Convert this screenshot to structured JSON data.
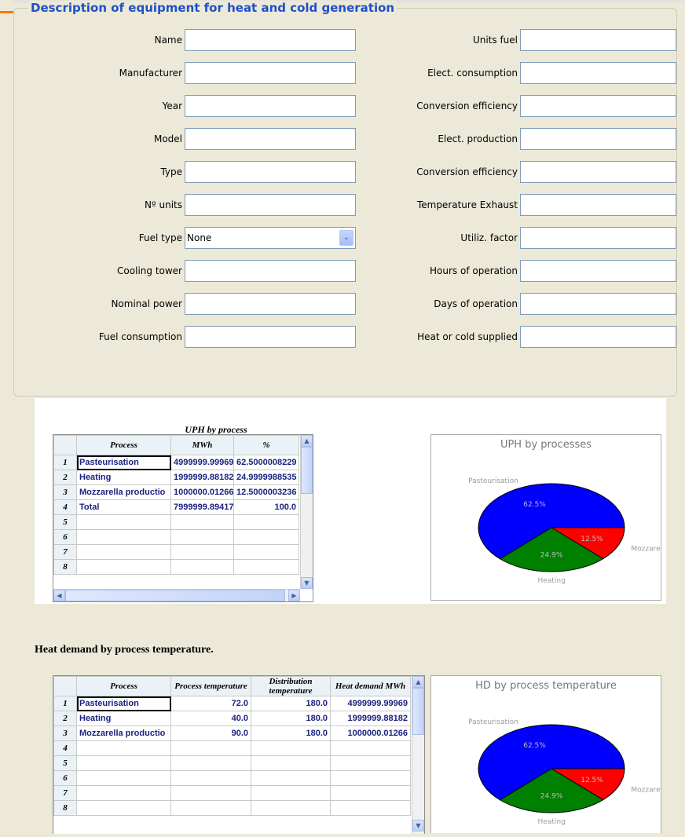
{
  "form": {
    "legend": "Description of equipment for heat and cold generation",
    "left_fields": [
      {
        "label": "Name",
        "value": ""
      },
      {
        "label": "Manufacturer",
        "value": ""
      },
      {
        "label": "Year",
        "value": ""
      },
      {
        "label": "Model",
        "value": ""
      },
      {
        "label": "Type",
        "value": ""
      },
      {
        "label": "Nº units",
        "value": ""
      },
      {
        "label": "Fuel type",
        "value": "None"
      },
      {
        "label": "Cooling tower",
        "value": ""
      },
      {
        "label": "Nominal power",
        "value": ""
      },
      {
        "label": "Fuel consumption",
        "value": ""
      }
    ],
    "right_fields": [
      {
        "label": "Units fuel",
        "value": ""
      },
      {
        "label": "Elect. consumption",
        "value": ""
      },
      {
        "label": "Conversion efficiency",
        "value": ""
      },
      {
        "label": "Elect. production",
        "value": ""
      },
      {
        "label": "Conversion efficiency",
        "value": ""
      },
      {
        "label": "Temperature Exhaust",
        "value": ""
      },
      {
        "label": "Utiliz. factor",
        "value": ""
      },
      {
        "label": "Hours of operation",
        "value": ""
      },
      {
        "label": "Days of operation",
        "value": ""
      },
      {
        "label": "Heat or cold supplied",
        "value": ""
      }
    ]
  },
  "uph_table": {
    "caption": "UPH by process",
    "headers": [
      "Process",
      "MWh",
      "%"
    ],
    "rows": [
      {
        "n": "1",
        "process": "Pasteurisation",
        "mwh": "4999999.99969",
        "pct": "62.5000008229"
      },
      {
        "n": "2",
        "process": "Heating",
        "mwh": "1999999.88182",
        "pct": "24.9999988535"
      },
      {
        "n": "3",
        "process": "Mozzarella productio",
        "mwh": "1000000.01266",
        "pct": "12.5000003236"
      },
      {
        "n": "4",
        "process": "Total",
        "mwh": "7999999.89417",
        "pct": "100.0"
      },
      {
        "n": "5",
        "process": "",
        "mwh": "",
        "pct": ""
      },
      {
        "n": "6",
        "process": "",
        "mwh": "",
        "pct": ""
      },
      {
        "n": "7",
        "process": "",
        "mwh": "",
        "pct": ""
      },
      {
        "n": "8",
        "process": "",
        "mwh": "",
        "pct": ""
      }
    ]
  },
  "hd_section_title": "Heat demand by process temperature.",
  "hd_table": {
    "headers": [
      "Process",
      "Process temperature",
      "Distribution temperature",
      "Heat demand MWh"
    ],
    "rows": [
      {
        "n": "1",
        "process": "Pasteurisation",
        "ptemp": "72.0",
        "dtemp": "180.0",
        "hd": "4999999.99969"
      },
      {
        "n": "2",
        "process": "Heating",
        "ptemp": "40.0",
        "dtemp": "180.0",
        "hd": "1999999.88182"
      },
      {
        "n": "3",
        "process": "Mozzarella productio",
        "ptemp": "90.0",
        "dtemp": "180.0",
        "hd": "1000000.01266"
      },
      {
        "n": "4",
        "process": "",
        "ptemp": "",
        "dtemp": "",
        "hd": ""
      },
      {
        "n": "5",
        "process": "",
        "ptemp": "",
        "dtemp": "",
        "hd": ""
      },
      {
        "n": "6",
        "process": "",
        "ptemp": "",
        "dtemp": "",
        "hd": ""
      },
      {
        "n": "7",
        "process": "",
        "ptemp": "",
        "dtemp": "",
        "hd": ""
      },
      {
        "n": "8",
        "process": "",
        "ptemp": "",
        "dtemp": "",
        "hd": ""
      }
    ]
  },
  "colors": {
    "accent": "#1e50c8",
    "orange": "#f57b00",
    "pie_blue": "#0000ff",
    "pie_green": "#008000",
    "pie_red": "#ff0000"
  },
  "chart_data": [
    {
      "type": "pie",
      "title": "UPH by processes",
      "categories": [
        "Pasteurisation",
        "Heating",
        "Mozzarella product"
      ],
      "values": [
        62.5,
        24.9,
        12.5
      ],
      "slice_labels": [
        "62.5%",
        "24.9%",
        "12.5%"
      ],
      "colors": [
        "#0000ff",
        "#008000",
        "#ff0000"
      ]
    },
    {
      "type": "pie",
      "title": "HD by process temperature",
      "categories": [
        "Pasteurisation",
        "Heating",
        "Mozzarella product"
      ],
      "values": [
        62.5,
        24.9,
        12.5
      ],
      "slice_labels": [
        "62.5%",
        "24.9%",
        "12.5%"
      ],
      "colors": [
        "#0000ff",
        "#008000",
        "#ff0000"
      ]
    }
  ]
}
